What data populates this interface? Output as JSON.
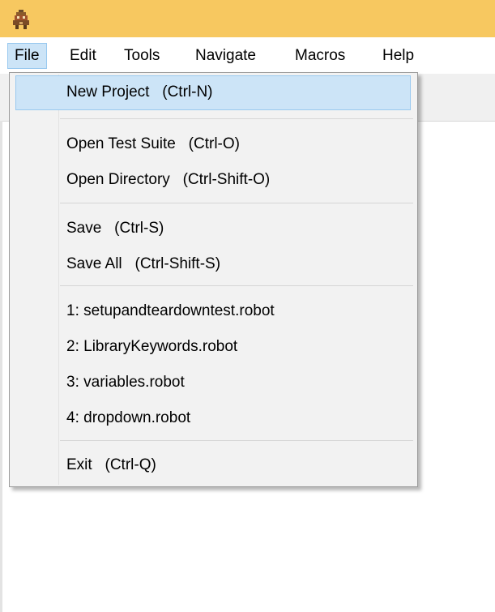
{
  "menubar": {
    "items": [
      "File",
      "Edit",
      "Tools",
      "Navigate",
      "Macros",
      "Help"
    ],
    "active": "File"
  },
  "file_menu": {
    "new_project": "New Project   (Ctrl-N)",
    "open_test_suite": "Open Test Suite   (Ctrl-O)",
    "open_directory": "Open Directory   (Ctrl-Shift-O)",
    "save": "Save   (Ctrl-S)",
    "save_all": "Save All   (Ctrl-Shift-S)",
    "recent": [
      "1: setupandteardowntest.robot",
      "2: LibraryKeywords.robot",
      "3: variables.robot",
      "4: dropdown.robot"
    ],
    "exit": "Exit   (Ctrl-Q)"
  },
  "colors": {
    "titlebar": "#f7c860",
    "menu_highlight": "#cce4f7",
    "menu_highlight_border": "#99c9ef",
    "dropdown_bg": "#f2f2f2"
  },
  "icons": {
    "app": "robot-ide-app-icon"
  }
}
